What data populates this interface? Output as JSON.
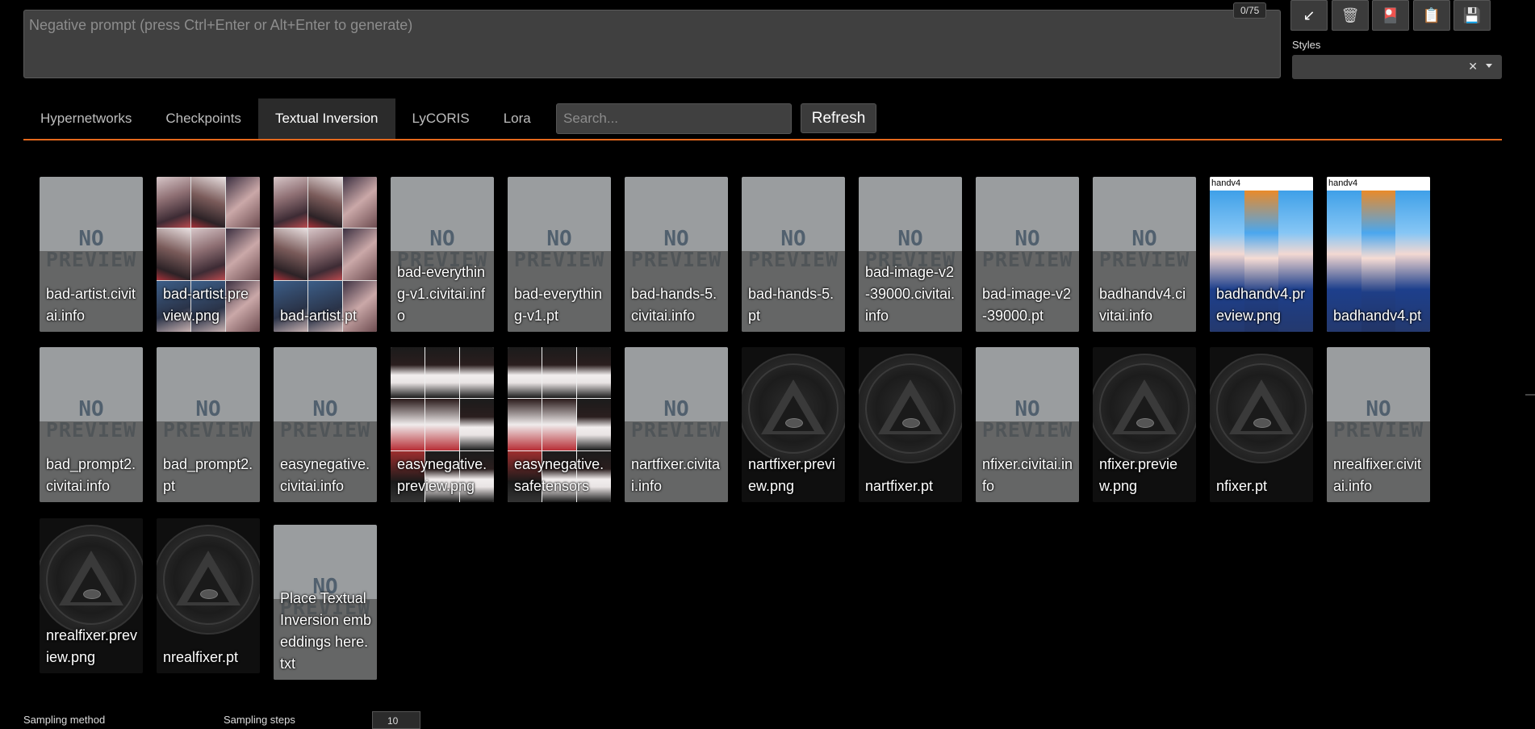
{
  "prompt": {
    "placeholder": "Negative prompt (press Ctrl+Enter or Alt+Enter to generate)",
    "token_count": "0/75"
  },
  "toolbar": {
    "buttons": [
      {
        "name": "restore-arrow-icon",
        "glyph": "↙",
        "color": "#ffffff"
      },
      {
        "name": "trash-icon",
        "glyph": "🗑",
        "color": "#cfcfcf"
      },
      {
        "name": "red-card-icon",
        "glyph": "🎴",
        "color": "#e0316e"
      },
      {
        "name": "clipboard-icon",
        "glyph": "📋",
        "color": "#e3b24a"
      },
      {
        "name": "save-icon",
        "glyph": "💾",
        "color": "#9b2bb5"
      }
    ],
    "styles_label": "Styles",
    "styles_clear": "✕"
  },
  "tabs": [
    "Hypernetworks",
    "Checkpoints",
    "Textual Inversion",
    "LyCORIS",
    "Lora"
  ],
  "selected_tab": "Textual Inversion",
  "search": {
    "placeholder": "Search..."
  },
  "refresh_label": "Refresh",
  "accent_color": "#e4681d",
  "no_preview": {
    "line1": "NO",
    "line2": "PREVIEW"
  },
  "cards": [
    {
      "name": "bad-artist.civitai.info",
      "thumb": "none"
    },
    {
      "name": "bad-artist.preview.png",
      "thumb": "grid"
    },
    {
      "name": "bad-artist.pt",
      "thumb": "grid"
    },
    {
      "name": "bad-everything-v1.civitai.info",
      "thumb": "none"
    },
    {
      "name": "bad-everything-v1.pt",
      "thumb": "none"
    },
    {
      "name": "bad-hands-5.civitai.info",
      "thumb": "none"
    },
    {
      "name": "bad-hands-5.pt",
      "thumb": "none"
    },
    {
      "name": "bad-image-v2-39000.civitai.info",
      "thumb": "none"
    },
    {
      "name": "bad-image-v2-39000.pt",
      "thumb": "none"
    },
    {
      "name": "badhandv4.civitai.info",
      "thumb": "none"
    },
    {
      "name": "badhandv4.preview.png",
      "thumb": "blue",
      "thumb_label": "handv4"
    },
    {
      "name": "badhandv4.pt",
      "thumb": "blue",
      "thumb_label": "handv4"
    },
    {
      "name": "bad_prompt2.civitai.info",
      "thumb": "none"
    },
    {
      "name": "bad_prompt2.pt",
      "thumb": "none"
    },
    {
      "name": "easynegative.civitai.info",
      "thumb": "none"
    },
    {
      "name": "easynegative.preview.png",
      "thumb": "maid"
    },
    {
      "name": "easynegative.safetensors",
      "thumb": "maid"
    },
    {
      "name": "nartfixer.civitai.info",
      "thumb": "none"
    },
    {
      "name": "nartfixer.preview.png",
      "thumb": "seal"
    },
    {
      "name": "nartfixer.pt",
      "thumb": "seal"
    },
    {
      "name": "nfixer.civitai.info",
      "thumb": "none"
    },
    {
      "name": "nfixer.preview.png",
      "thumb": "seal"
    },
    {
      "name": "nfixer.pt",
      "thumb": "seal"
    },
    {
      "name": "nrealfixer.civitai.info",
      "thumb": "none"
    },
    {
      "name": "nrealfixer.preview.png",
      "thumb": "seal"
    },
    {
      "name": "nrealfixer.pt",
      "thumb": "seal"
    },
    {
      "name": "Place Textual Inversion embeddings here.txt",
      "thumb": "none"
    }
  ],
  "bottom": {
    "sampling_method_label": "Sampling method",
    "sampling_steps_label": "Sampling steps",
    "sampling_steps_value": "10"
  }
}
